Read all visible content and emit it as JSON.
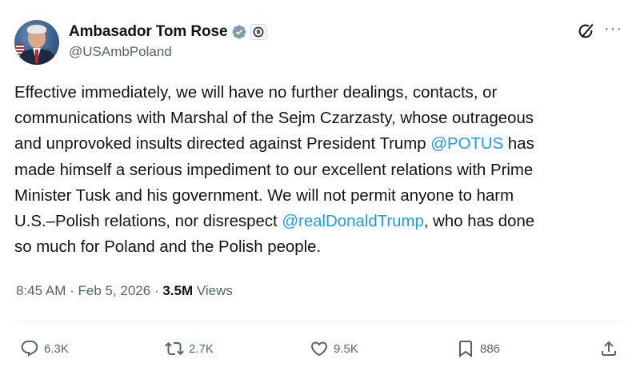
{
  "author": {
    "name": "Ambasador Tom Rose",
    "handle": "@USAmbPoland"
  },
  "post": {
    "text_1": "Effective immediately, we will have no further dealings, contacts, or\ncommunications with Marshal of the Sejm Czarzasty, whose outrageous\nand unprovoked insults directed  against President Trump ",
    "mention_1": "@POTUS",
    "text_2": " has\nmade himself a serious impediment to our excellent relations with Prime\nMinister Tusk and his government. We will not permit anyone to harm\nU.S.–Polish relations, nor disrespect ",
    "mention_2": "@realDonaldTrump",
    "text_3": ", who has done\nso much for Poland and the Polish people."
  },
  "meta": {
    "time": "8:45 AM",
    "sep1": " · ",
    "date": "Feb 5, 2026",
    "sep2": " · ",
    "views_count": "3.5M",
    "views_label": " Views"
  },
  "actions": {
    "replies": "6.3K",
    "reposts": "2.7K",
    "likes": "9.5K",
    "bookmarks": "886"
  },
  "colors": {
    "link": "#1d9bf0",
    "secondary_text": "#536471",
    "verified_badge": "#829aab"
  },
  "icons": [
    "verified-badge-icon",
    "government-seal-icon",
    "grok-icon",
    "more-icon",
    "reply-icon",
    "repost-icon",
    "like-icon",
    "bookmark-icon",
    "share-icon"
  ]
}
